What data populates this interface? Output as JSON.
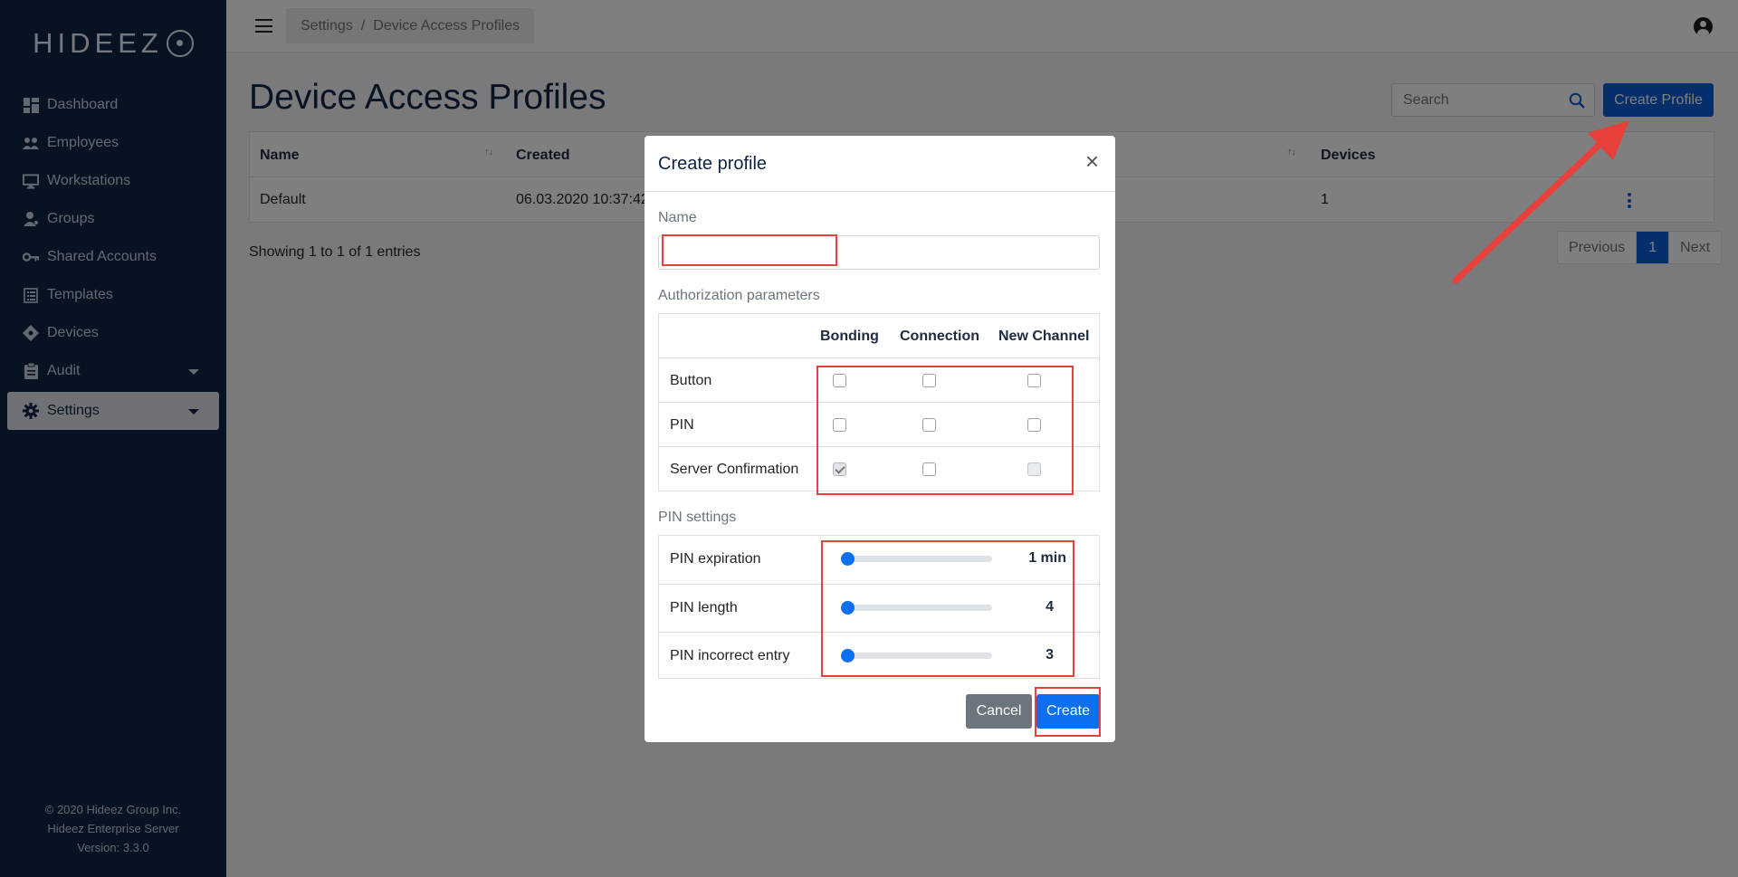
{
  "app": {
    "logo_text": "HIDEEZ"
  },
  "sidebar": {
    "items": [
      {
        "label": "Dashboard",
        "icon": "dashboard-icon"
      },
      {
        "label": "Employees",
        "icon": "users-icon"
      },
      {
        "label": "Workstations",
        "icon": "monitor-icon"
      },
      {
        "label": "Groups",
        "icon": "group-icon"
      },
      {
        "label": "Shared Accounts",
        "icon": "key-icon"
      },
      {
        "label": "Templates",
        "icon": "list-icon"
      },
      {
        "label": "Devices",
        "icon": "device-icon"
      },
      {
        "label": "Audit",
        "icon": "clipboard-icon",
        "has_caret": true
      },
      {
        "label": "Settings",
        "icon": "gear-icon",
        "has_caret": true,
        "active": true
      }
    ],
    "footer": {
      "line1": "© 2020 Hideez Group Inc.",
      "line2": "Hideez Enterprise Server",
      "line3": "Version: 3.3.0"
    }
  },
  "topbar": {
    "breadcrumb": [
      "Settings",
      "Device Access Profiles"
    ],
    "breadcrumb_sep": "/"
  },
  "page": {
    "title": "Device Access Profiles",
    "search_placeholder": "Search",
    "create_button": "Create Profile",
    "table": {
      "headers": {
        "name": "Name",
        "created": "Created",
        "devices": "Devices"
      },
      "rows": [
        {
          "name": "Default",
          "created": "06.03.2020 10:37:42",
          "devices": "1"
        }
      ]
    },
    "showing_text": "Showing 1 to 1 of 1 entries",
    "pager": {
      "previous": "Previous",
      "current": "1",
      "next": "Next"
    }
  },
  "modal": {
    "title": "Create profile",
    "close_glyph": "×",
    "name_label": "Name",
    "name_value": "",
    "auth_label": "Authorization parameters",
    "auth_columns": [
      "Bonding",
      "Connection",
      "New Channel"
    ],
    "auth_rows": [
      {
        "label": "Button",
        "values": [
          false,
          false,
          false
        ]
      },
      {
        "label": "PIN",
        "values": [
          false,
          false,
          false
        ]
      },
      {
        "label": "Server Confirmation",
        "values": [
          true,
          false,
          false
        ]
      }
    ],
    "pin_label": "PIN settings",
    "pin_rows": [
      {
        "label": "PIN expiration",
        "value_text": "1 min",
        "fraction": 0
      },
      {
        "label": "PIN length",
        "value_text": "4",
        "fraction": 0
      },
      {
        "label": "PIN incorrect entry",
        "value_text": "3",
        "fraction": 0
      }
    ],
    "cancel_label": "Cancel",
    "create_label": "Create"
  },
  "colors": {
    "sidebar_bg": "#0f2444",
    "primary": "#0b5cd4",
    "annotation_red": "#e8403a"
  }
}
